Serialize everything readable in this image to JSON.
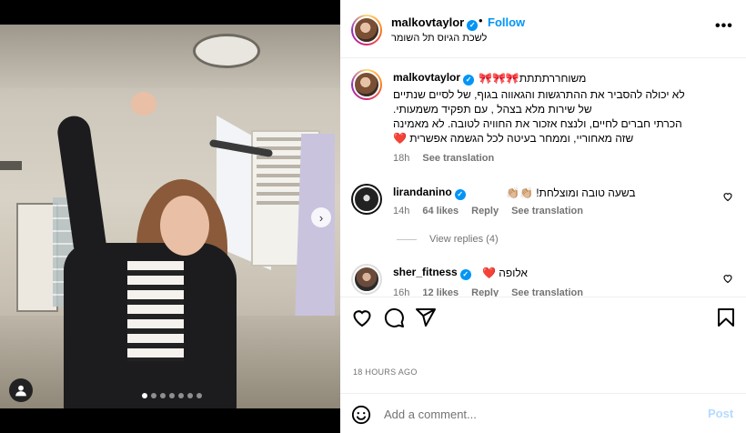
{
  "header": {
    "username": "malkovtaylor",
    "separator": "•",
    "follow_label": "Follow",
    "location": "לשכת הגיוס תל השומר",
    "more_label": "•••"
  },
  "caption": {
    "username": "malkovtaylor",
    "lines": [
      "משוחררתתתת🎀🎀🎀",
      "לא יכולה להסביר את ההתרגשות והגאווה בגוף, של לסיים שנתיים",
      "של שירות מלא בצהל , עם תפקיד משמעותי.",
      "הכרתי חברים לחיים, ולנצח אזכור את החוויה לטובה. לא מאמינה",
      "שזה מאחוריי, וממחר בעיטה לכל הגשמה אפשרית ❤️"
    ],
    "time": "18h",
    "see_translation": "See translation"
  },
  "comments": [
    {
      "username": "lirandanino",
      "text": "בשעה טובה ומוצלחת! 👏🏼👏🏼",
      "time": "14h",
      "likes": "64 likes",
      "reply": "Reply",
      "see_translation": "See translation",
      "view_replies": "View replies (4)"
    },
    {
      "username": "sher_fitness",
      "text": "אלופה ❤️",
      "time": "16h",
      "likes": "12 likes",
      "reply": "Reply",
      "see_translation": "See translation"
    }
  ],
  "post": {
    "time_ago": "18 HOURS AGO",
    "next_label": "›"
  },
  "add_comment": {
    "placeholder": "Add a comment...",
    "post_label": "Post"
  },
  "carousel": {
    "total": 7,
    "active": 0
  },
  "colors": {
    "accent": "#0095f6",
    "post_disabled": "#b3dbff",
    "like_red": "#ed4956"
  },
  "icons": [
    "heart-icon",
    "comment-icon",
    "share-icon",
    "save-icon",
    "emoji-icon",
    "more-icon",
    "user-tag-icon",
    "verified-icon"
  ]
}
